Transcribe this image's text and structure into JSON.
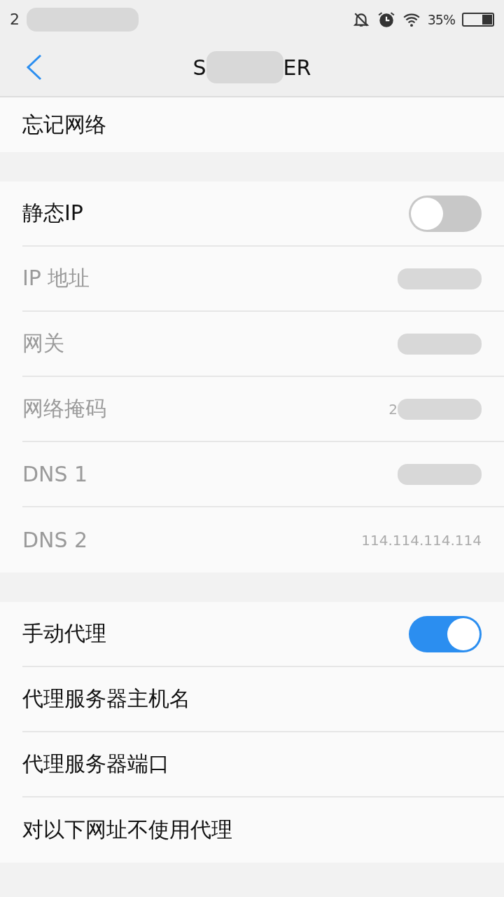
{
  "status_bar": {
    "time": "2",
    "time_redacted": true,
    "battery": "35%"
  },
  "header": {
    "title_start": "S",
    "title_end": "ER",
    "title_redacted": true
  },
  "sections": [
    {
      "rows": [
        {
          "kind": "action",
          "label": "忘记网络",
          "disabled": false
        }
      ]
    },
    {
      "rows": [
        {
          "kind": "switch",
          "label": "静态IP",
          "disabled": false,
          "on": false
        },
        {
          "kind": "field",
          "label": "IP 地址",
          "disabled": true,
          "redacted": true
        },
        {
          "kind": "field",
          "label": "网关",
          "disabled": true,
          "redacted": true
        },
        {
          "kind": "field",
          "label": "网络掩码",
          "disabled": true,
          "value": "2",
          "redacted": true
        },
        {
          "kind": "field",
          "label": "DNS 1",
          "disabled": true,
          "redacted": true
        },
        {
          "kind": "field",
          "label": "DNS 2",
          "disabled": true,
          "value": "114.114.114.114",
          "redacted": false
        }
      ]
    },
    {
      "rows": [
        {
          "kind": "switch",
          "label": "手动代理",
          "disabled": false,
          "on": true
        },
        {
          "kind": "action",
          "label": "代理服务器主机名",
          "disabled": false
        },
        {
          "kind": "action",
          "label": "代理服务器端口",
          "disabled": false
        },
        {
          "kind": "action",
          "label": "对以下网址不使用代理",
          "disabled": false
        }
      ]
    }
  ]
}
